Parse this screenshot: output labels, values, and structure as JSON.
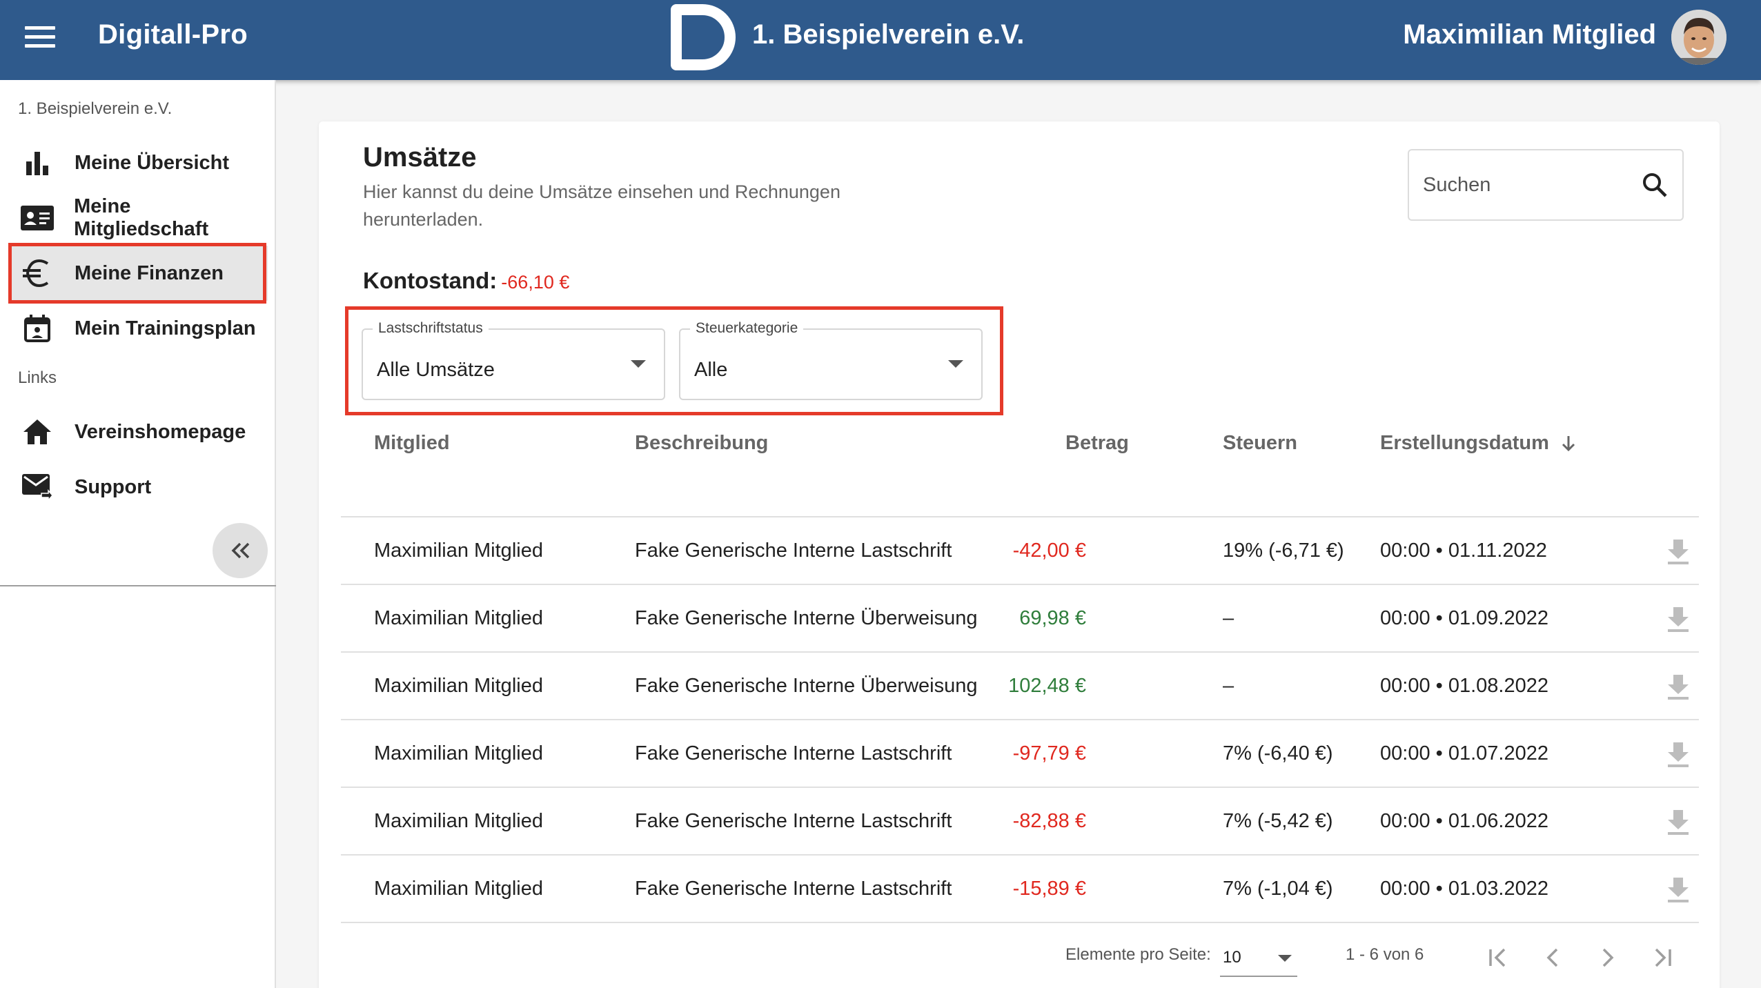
{
  "header": {
    "app_title": "Digitall-Pro",
    "org_title": "1. Beispielverein e.V.",
    "user_name": "Maximilian Mitglied"
  },
  "sidebar": {
    "org_label": "1. Beispielverein e.V.",
    "items": [
      {
        "label": "Meine Übersicht",
        "icon": "bar-chart-icon"
      },
      {
        "label": "Meine Mitgliedschaft",
        "icon": "id-card-icon"
      },
      {
        "label": "Meine Finanzen",
        "icon": "euro-icon",
        "active": true
      },
      {
        "label": "Mein Trainingsplan",
        "icon": "calendar-person-icon"
      }
    ],
    "links_label": "Links",
    "links": [
      {
        "label": "Vereinshomepage",
        "icon": "home-icon"
      },
      {
        "label": "Support",
        "icon": "mail-forward-icon"
      }
    ]
  },
  "main": {
    "title": "Umsätze",
    "subtitle": "Hier kannst du deine Umsätze einsehen und Rechnungen herunterladen.",
    "search_placeholder": "Suchen",
    "balance_label": "Kontostand:",
    "balance_value": "-66,10 €",
    "filters": {
      "status_label": "Lastschriftstatus",
      "status_value": "Alle Umsätze",
      "tax_label": "Steuerkategorie",
      "tax_value": "Alle"
    },
    "columns": {
      "member": "Mitglied",
      "description": "Beschreibung",
      "amount": "Betrag",
      "taxes": "Steuern",
      "date": "Erstellungsdatum"
    },
    "rows": [
      {
        "member": "Maximilian Mitglied",
        "description": "Fake Generische Interne Lastschrift",
        "amount": "-42,00 €",
        "sign": "neg",
        "taxes": "19% (-6,71 €)",
        "date": "00:00 • 01.11.2022"
      },
      {
        "member": "Maximilian Mitglied",
        "description": "Fake Generische Interne Überweisung",
        "amount": "69,98 €",
        "sign": "pos",
        "taxes": "–",
        "date": "00:00 • 01.09.2022"
      },
      {
        "member": "Maximilian Mitglied",
        "description": "Fake Generische Interne Überweisung",
        "amount": "102,48 €",
        "sign": "pos",
        "taxes": "–",
        "date": "00:00 • 01.08.2022"
      },
      {
        "member": "Maximilian Mitglied",
        "description": "Fake Generische Interne Lastschrift",
        "amount": "-97,79 €",
        "sign": "neg",
        "taxes": "7% (-6,40 €)",
        "date": "00:00 • 01.07.2022"
      },
      {
        "member": "Maximilian Mitglied",
        "description": "Fake Generische Interne Lastschrift",
        "amount": "-82,88 €",
        "sign": "neg",
        "taxes": "7% (-5,42 €)",
        "date": "00:00 • 01.06.2022"
      },
      {
        "member": "Maximilian Mitglied",
        "description": "Fake Generische Interne Lastschrift",
        "amount": "-15,89 €",
        "sign": "neg",
        "taxes": "7% (-1,04 €)",
        "date": "00:00 • 01.03.2022"
      }
    ],
    "paginator": {
      "per_page_label": "Elemente pro Seite:",
      "per_page_value": "10",
      "range": "1 - 6 von 6"
    }
  },
  "colors": {
    "header_bg": "#2f5a8c",
    "negative": "#e0281f",
    "positive": "#2f7d3b",
    "highlight": "#e53a2a"
  }
}
